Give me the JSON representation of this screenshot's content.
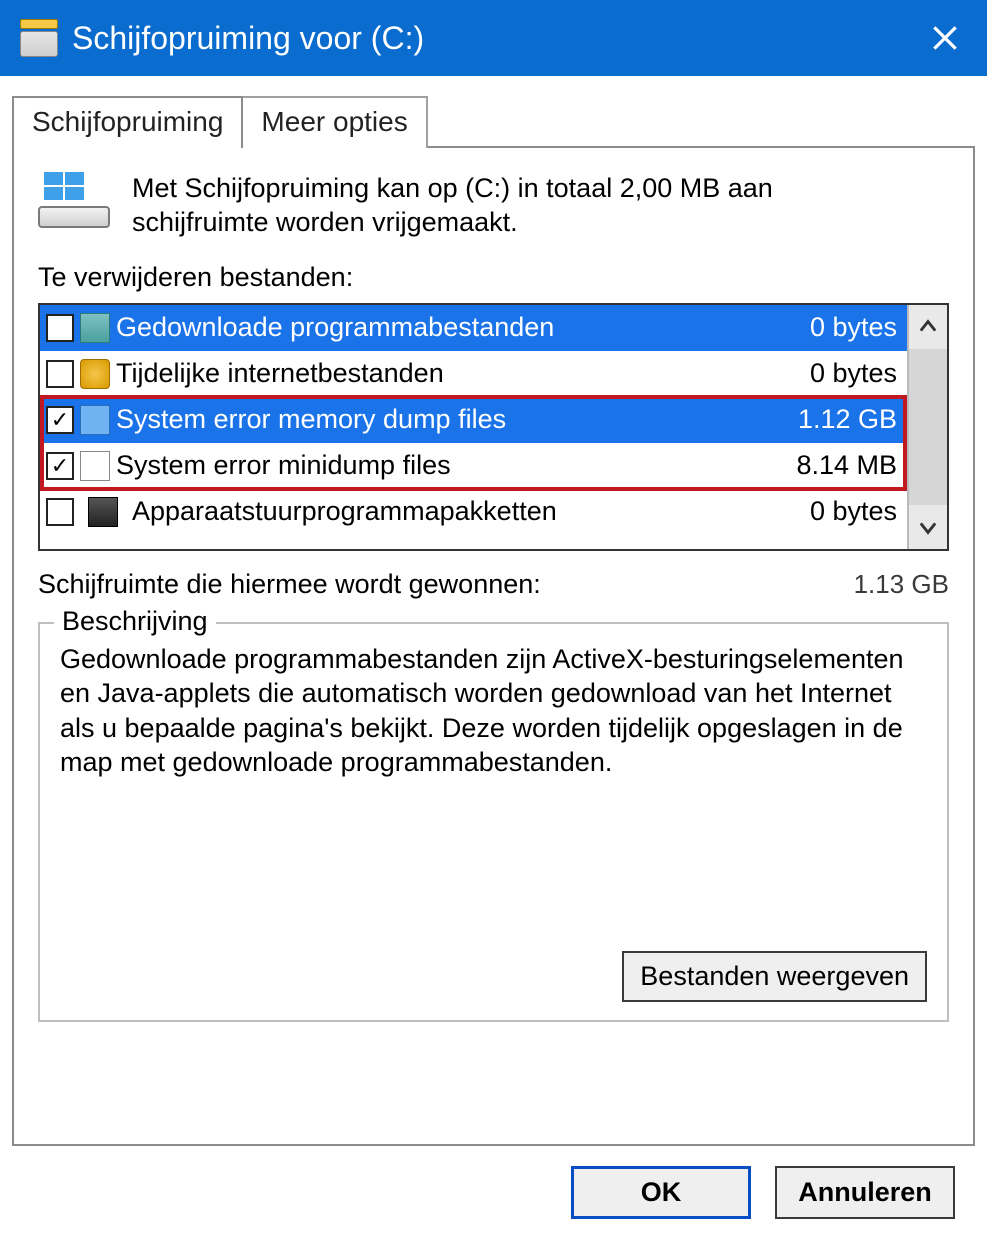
{
  "window": {
    "title": "Schijfopruiming voor  (C:)"
  },
  "tabs": {
    "tab1": "Schijfopruiming",
    "tab2": "Meer opties"
  },
  "intro": "Met Schijfopruiming kan op  (C:) in totaal 2,00 MB aan schijfruimte worden vrijgemaakt.",
  "list_label": "Te verwijderen bestanden:",
  "items": [
    {
      "name": "Gedownloade programmabestanden",
      "size": "0 bytes",
      "checked": false,
      "selected": true,
      "icon": "ic-folder"
    },
    {
      "name": "Tijdelijke internetbestanden",
      "size": "0 bytes",
      "checked": false,
      "selected": false,
      "icon": "ic-lock"
    },
    {
      "name": "System error memory dump files",
      "size": "1.12 GB",
      "checked": true,
      "selected": true,
      "icon": "ic-file-b"
    },
    {
      "name": "System error minidump files",
      "size": "8.14 MB",
      "checked": true,
      "selected": false,
      "icon": "ic-file"
    },
    {
      "name": "Apparaatstuurprogrammapakketten",
      "size": "0 bytes",
      "checked": false,
      "selected": false,
      "icon": "ic-dev"
    }
  ],
  "gained_label": "Schijfruimte die hiermee wordt gewonnen:",
  "gained_value": "1.13 GB",
  "group_title": "Beschrijving",
  "description": "Gedownloade programmabestanden zijn ActiveX-besturingselementen en Java-applets die automatisch worden gedownload van het Internet als u bepaalde pagina's bekijkt. Deze worden tijdelijk opgeslagen in de map met gedownloade programmabestanden.",
  "buttons": {
    "view_files": "Bestanden weergeven",
    "ok": "OK",
    "cancel": "Annuleren"
  }
}
